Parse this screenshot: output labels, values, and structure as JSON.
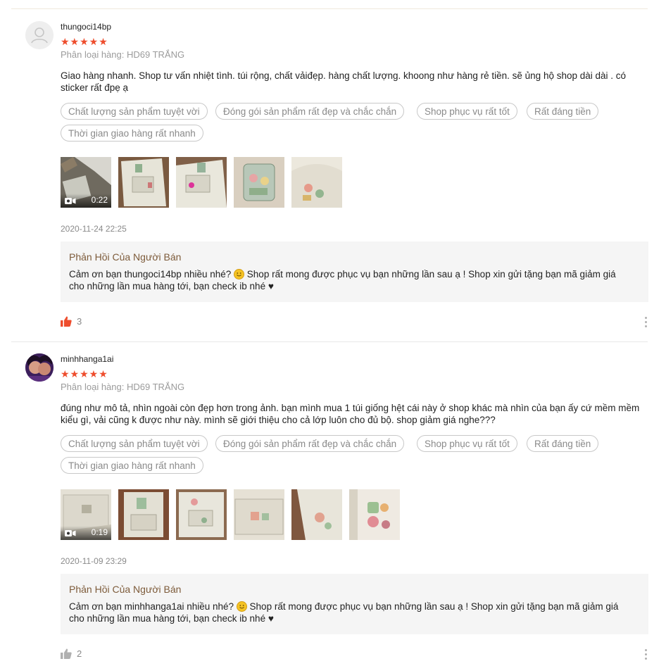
{
  "reviews": [
    {
      "username": "thungoci14bp",
      "stars": "★★★★★",
      "rating": 5,
      "variant": "Phân loại hàng: HD69 TRẮNG",
      "comment": "Giao hàng nhanh. Shop tư vấn nhiệt tình. túi rộng, chất vảiđẹp.  hàng chất lượng. khoong như hàng rẻ tiền. sẽ ủng hộ shop dài dài . có sticker rất đpẹ ạ",
      "tags": [
        "Chất lượng sản phẩm tuyệt vời",
        "Đóng gói sản phẩm rất đẹp và chắc chắn",
        "Shop phục vụ rất tốt",
        "Rất đáng tiền",
        "Thời gian giao hàng rất nhanh"
      ],
      "video_duration": "0:22",
      "date": "2020-11-24 22:25",
      "reply_title": "Phản Hồi Của Người Bán",
      "reply_pre": "Cảm ơn bạn thungoci14bp nhiều nhé?",
      "reply_post": " Shop rất mong được phục vụ bạn những lần sau ạ ! Shop xin gửi tặng bạn mã giảm giá cho những lần mua hàng tới, bạn check ib nhé ♥",
      "likes": "3",
      "liked": true
    },
    {
      "username": "minhhanga1ai",
      "stars": "★★★★★",
      "rating": 5,
      "variant": "Phân loại hàng: HD69 TRẮNG",
      "comment": "đúng như mô tả, nhìn ngoài còn đẹp hơn trong ảnh.  bạn mình mua 1 túi giống hệt cái này ở shop khác mà nhìn của bạn ấy cứ mềm mềm kiểu gì, vải cũng k được như này. mình sẽ giới thiệu cho cả lớp luôn cho đủ bộ. shop giảm giá nghe???",
      "tags": [
        "Chất lượng sản phẩm tuyệt vời",
        "Đóng gói sản phẩm rất đẹp và chắc chắn",
        "Shop phục vụ rất tốt",
        "Rất đáng tiền",
        "Thời gian giao hàng rất nhanh"
      ],
      "video_duration": "0:19",
      "date": "2020-11-09 23:29",
      "reply_title": "Phản Hồi Của Người Bán",
      "reply_pre": "Cảm ơn bạn minhhanga1ai nhiều nhé?",
      "reply_post": " Shop rất mong được phục vụ bạn những lần sau ạ ! Shop xin gửi tặng bạn mã giảm giá cho những lần mua hàng tới, bạn check ib nhé ♥",
      "likes": "2",
      "liked": false
    }
  ],
  "colors": {
    "star": "#ee4d2d",
    "like_active": "#ee4d2d",
    "like_inactive": "#b0b0b0",
    "reply_title": "#7d5b3a"
  },
  "icons": [
    "default-avatar-icon",
    "star-icon",
    "video-camera-icon",
    "thumbs-up-icon",
    "more-options-icon",
    "smiley-emoji-icon"
  ]
}
